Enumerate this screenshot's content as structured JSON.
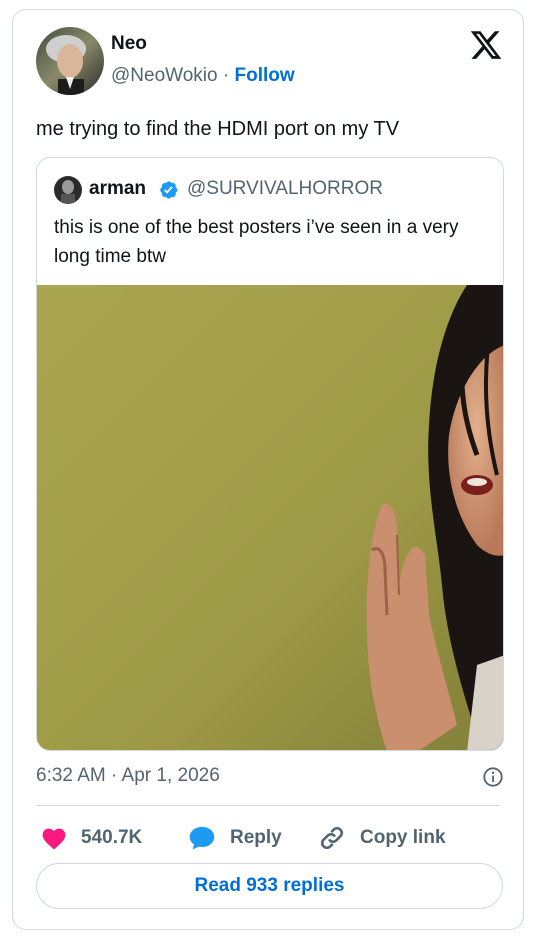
{
  "author": {
    "name": "Neo",
    "handle": "@NeoWokio",
    "separator": "·",
    "follow_label": "Follow"
  },
  "tweet": {
    "text": "me trying to find the HDMI port on my TV",
    "timestamp": "6:32 AM · Apr 1, 2026"
  },
  "quoted": {
    "name": "arman",
    "handle": "@SURVIVALHORROR",
    "text": "this is one of the best posters i’ve seen in a very long time btw"
  },
  "actions": {
    "like_count": "540.7K",
    "reply_label": "Reply",
    "copy_label": "Copy link"
  },
  "read_replies_label": "Read 933 replies",
  "icons": {
    "brand": "x-logo-icon",
    "verified": "verified-badge-icon",
    "info": "info-icon",
    "like": "heart-icon",
    "reply": "speech-bubble-icon",
    "copy": "link-icon"
  },
  "colors": {
    "accent_blue": "#006fd6",
    "verified_blue": "#1d9bf0",
    "like_pink": "#f91880",
    "muted_text": "#536471",
    "border": "#cfd9de"
  }
}
